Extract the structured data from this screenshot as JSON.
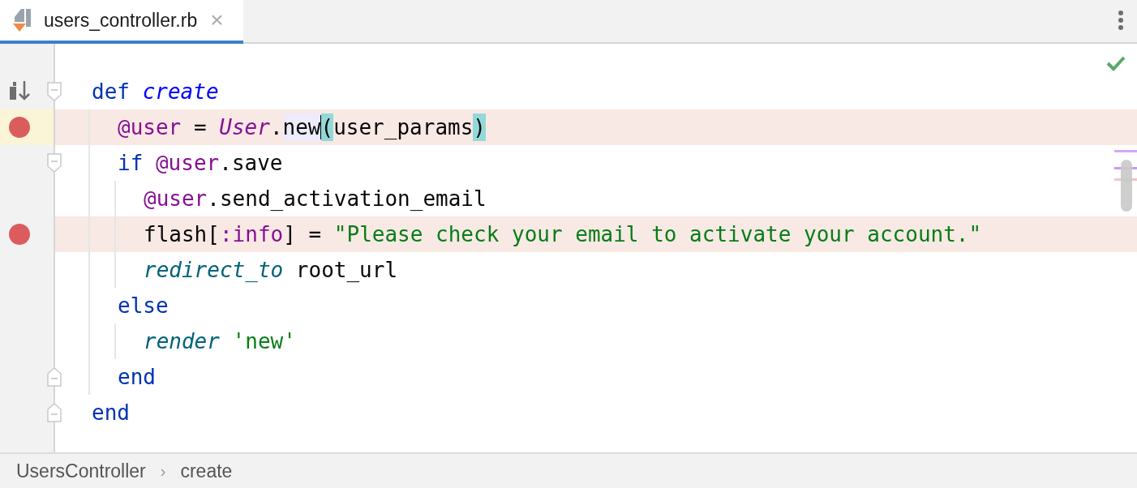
{
  "tab": {
    "label": "users_controller.rb",
    "selected": true,
    "close": "×"
  },
  "code": [
    {
      "fold_start": true,
      "fold_end": false,
      "breakpoint": false,
      "current": false,
      "tokens": [
        {
          "kind": "keyword",
          "text": "def "
        },
        {
          "kind": "method_def",
          "text": "create"
        }
      ],
      "children": [
        {
          "fold_start": false,
          "fold_end": false,
          "breakpoint": true,
          "current": true,
          "tokens": [
            {
              "kind": "ivar",
              "text": "@user"
            },
            {
              "kind": "plain",
              "text": " = "
            },
            {
              "kind": "const",
              "text": "User"
            },
            {
              "kind": "plain",
              "text": "."
            },
            {
              "kind": "usage",
              "text": "new",
              "caret": true
            },
            {
              "kind": "brace",
              "text": "("
            },
            {
              "kind": "plain",
              "text": "user_params"
            },
            {
              "kind": "brace",
              "text": ")"
            }
          ]
        },
        {
          "fold_start": true,
          "fold_end": false,
          "breakpoint": false,
          "current": false,
          "tokens": [
            {
              "kind": "keyword",
              "text": "if "
            },
            {
              "kind": "ivar",
              "text": "@user"
            },
            {
              "kind": "plain",
              "text": ".save"
            }
          ],
          "children": [
            {
              "fold_start": false,
              "fold_end": false,
              "breakpoint": false,
              "current": false,
              "tokens": [
                {
                  "kind": "ivar",
                  "text": "@user"
                },
                {
                  "kind": "plain",
                  "text": ".send_activation_email"
                }
              ]
            },
            {
              "fold_start": false,
              "fold_end": false,
              "breakpoint": true,
              "current": false,
              "tokens": [
                {
                  "kind": "plain",
                  "text": "flash["
                },
                {
                  "kind": "symbol",
                  "text": ":info"
                },
                {
                  "kind": "plain",
                  "text": "] = "
                },
                {
                  "kind": "string",
                  "text": "\"Please check your email to activate your account.\""
                }
              ]
            },
            {
              "fold_start": false,
              "fold_end": false,
              "breakpoint": false,
              "current": false,
              "tokens": [
                {
                  "kind": "call",
                  "text": "redirect_to"
                },
                {
                  "kind": "plain",
                  "text": " root_url"
                }
              ]
            }
          ]
        },
        {
          "fold_start": false,
          "fold_end": false,
          "breakpoint": false,
          "current": false,
          "tokens": [
            {
              "kind": "keyword",
              "text": "else"
            }
          ],
          "children": [
            {
              "fold_start": false,
              "fold_end": false,
              "breakpoint": false,
              "current": false,
              "tokens": [
                {
                  "kind": "call",
                  "text": "render "
                },
                {
                  "kind": "string",
                  "text": "'new'"
                }
              ]
            }
          ]
        },
        {
          "fold_start": false,
          "fold_end": true,
          "breakpoint": false,
          "current": false,
          "tokens": [
            {
              "kind": "keyword",
              "text": "end"
            }
          ]
        }
      ]
    },
    {
      "fold_start": false,
      "fold_end": true,
      "breakpoint": false,
      "current": false,
      "tokens": [
        {
          "kind": "keyword",
          "text": "end"
        }
      ]
    }
  ],
  "breadcrumbs": [
    "UsersController",
    "create"
  ],
  "breadcrumb_separator": "›"
}
